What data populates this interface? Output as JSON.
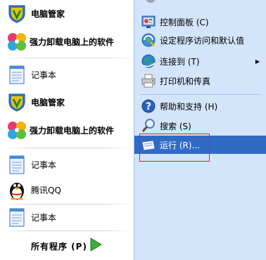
{
  "left_items": [
    {
      "label": "电脑管家",
      "bold": true,
      "icon": "shield-icon"
    },
    {
      "label": "强力卸载电脑上的软件",
      "bold": true,
      "icon": "pinwheel-icon"
    },
    {
      "label": "记事本",
      "bold": false,
      "icon": "notepad-icon"
    },
    {
      "label": "电脑管家",
      "bold": true,
      "icon": "shield-icon"
    },
    {
      "label": "强力卸载电脑上的软件",
      "bold": true,
      "icon": "pinwheel-icon"
    },
    {
      "label": "记事本",
      "bold": false,
      "icon": "notepad-icon"
    },
    {
      "label": "腾讯QQ",
      "bold": false,
      "icon": "qq-penguin-icon"
    },
    {
      "label": "记事本",
      "bold": false,
      "icon": "notepad-icon"
    }
  ],
  "all_programs": {
    "label": "所有程序 (P)",
    "icon": "green-arrow-icon"
  },
  "right_items": [
    {
      "label": "控制面板 (C)",
      "icon": "control-panel-icon"
    },
    {
      "label": "设定程序访问和默认值",
      "icon": "program-access-icon"
    },
    {
      "label": "连接到 (T)",
      "icon": "globe-icon",
      "submenu": "▶"
    },
    {
      "label": "打印机和传真",
      "icon": "printer-icon"
    },
    {
      "label": "帮助和支持 (H)",
      "icon": "help-icon"
    },
    {
      "label": "搜索 (S)",
      "icon": "magnifier-icon"
    },
    {
      "label": "运行 (R)...",
      "icon": "run-icon"
    }
  ],
  "colors": {
    "highlight": "#316ac5",
    "right_panel": "#d3e5fa",
    "annotation_box": "#e02020"
  }
}
